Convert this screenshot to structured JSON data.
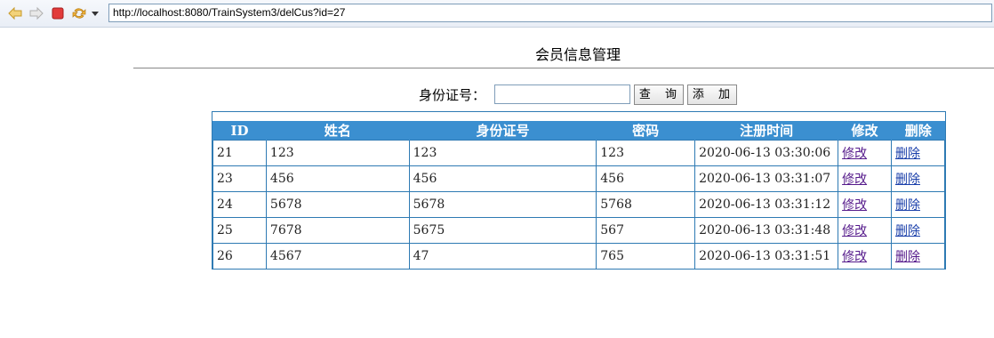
{
  "browser": {
    "url": "http://localhost:8080/TrainSystem3/delCus?id=27",
    "icons": [
      "back-arrow-icon",
      "forward-arrow-icon",
      "stop-icon",
      "refresh-icon",
      "dropdown-icon"
    ]
  },
  "page": {
    "title": "会员信息管理",
    "search_label": "身份证号：",
    "search_value": "",
    "query_button": "查 询",
    "add_button": "添 加"
  },
  "table": {
    "headers": [
      "ID",
      "姓名",
      "身份证号",
      "密码",
      "注册时间",
      "修改",
      "删除"
    ],
    "rows": [
      {
        "id": "21",
        "name": "123",
        "idcard": "123",
        "password": "123",
        "time": "2020-06-13 03:30:06",
        "edit": "修改",
        "del": "删除"
      },
      {
        "id": "23",
        "name": "456",
        "idcard": "456",
        "password": "456",
        "time": "2020-06-13 03:31:07",
        "edit": "修改",
        "del": "删除"
      },
      {
        "id": "24",
        "name": "5678",
        "idcard": "5678",
        "password": "5768",
        "time": "2020-06-13 03:31:12",
        "edit": "修改",
        "del": "删除"
      },
      {
        "id": "25",
        "name": "7678",
        "idcard": "5675",
        "password": "567",
        "time": "2020-06-13 03:31:48",
        "edit": "修改",
        "del": "删除"
      },
      {
        "id": "26",
        "name": "4567",
        "idcard": "47",
        "password": "765",
        "time": "2020-06-13 03:31:51",
        "edit": "修改",
        "del": "删除"
      }
    ]
  },
  "colors": {
    "header_bg": "#3b8fd0",
    "border": "#2e7ab3",
    "visited_link": "#551a8b",
    "link": "#1a3faa"
  }
}
